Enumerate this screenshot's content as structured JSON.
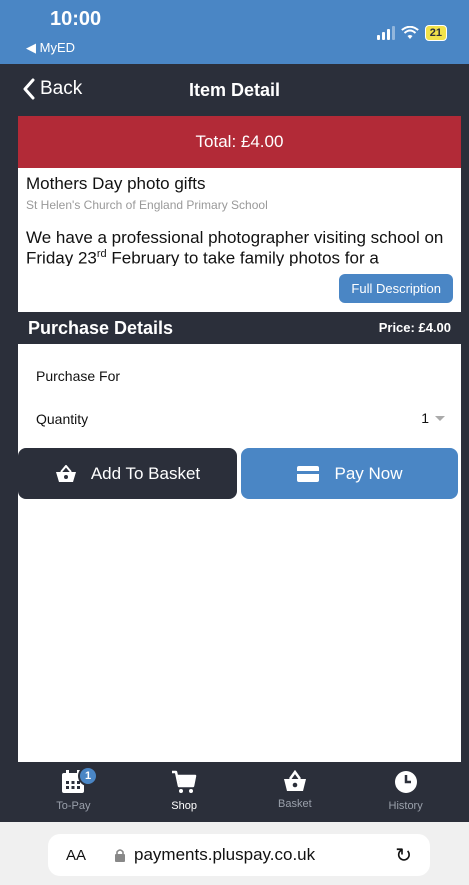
{
  "status_bar": {
    "time": "10:00",
    "back_app": "◀ MyED",
    "battery": "21"
  },
  "nav": {
    "back_label": "Back",
    "title": "Item Detail"
  },
  "total": "Total: £4.00",
  "item": {
    "name": "Mothers Day photo gifts",
    "school": "St Helen's Church of England Primary School",
    "desc_part1": "We have a professional photographer visiting school on Friday 23",
    "desc_sup": "rd",
    "desc_part2": " February to take family photos for a",
    "full_desc_label": "Full Description"
  },
  "purchase": {
    "header": "Purchase Details",
    "price": "Price: £4.00",
    "purchase_for_label": "Purchase For",
    "quantity_label": "Quantity",
    "quantity_value": "1"
  },
  "buttons": {
    "add_to_basket": "Add To Basket",
    "pay_now": "Pay Now"
  },
  "tabs": [
    {
      "label": "To-Pay",
      "badge": "1",
      "icon": "calendar-icon"
    },
    {
      "label": "Shop",
      "icon": "cart-icon"
    },
    {
      "label": "Basket",
      "icon": "basket-icon"
    },
    {
      "label": "History",
      "icon": "clock-icon"
    }
  ],
  "browser": {
    "aa": "AA",
    "url": "payments.pluspay.co.uk"
  },
  "colors": {
    "accent": "#4a86c5",
    "dark": "#2b2f3a",
    "total_red": "#b22a37"
  }
}
